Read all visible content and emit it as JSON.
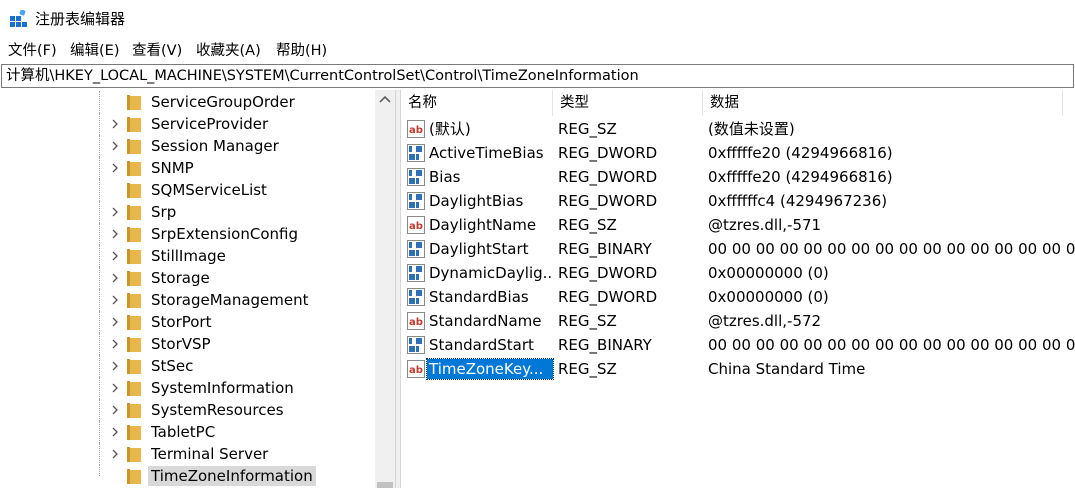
{
  "window": {
    "title": "注册表编辑器",
    "icon": "regedit-icon"
  },
  "menu": [
    {
      "label": "文件(F)"
    },
    {
      "label": "编辑(E)"
    },
    {
      "label": "查看(V)"
    },
    {
      "label": "收藏夹(A)"
    },
    {
      "label": "帮助(H)"
    }
  ],
  "address": {
    "path": "计算机\\HKEY_LOCAL_MACHINE\\SYSTEM\\CurrentControlSet\\Control\\TimeZoneInformation"
  },
  "tree": {
    "items": [
      {
        "label": "ServiceGroupOrder",
        "expandable": false
      },
      {
        "label": "ServiceProvider",
        "expandable": true
      },
      {
        "label": "Session Manager",
        "expandable": true
      },
      {
        "label": "SNMP",
        "expandable": true
      },
      {
        "label": "SQMServiceList",
        "expandable": false
      },
      {
        "label": "Srp",
        "expandable": true
      },
      {
        "label": "SrpExtensionConfig",
        "expandable": true
      },
      {
        "label": "StillImage",
        "expandable": true
      },
      {
        "label": "Storage",
        "expandable": true
      },
      {
        "label": "StorageManagement",
        "expandable": true
      },
      {
        "label": "StorPort",
        "expandable": true
      },
      {
        "label": "StorVSP",
        "expandable": true
      },
      {
        "label": "StSec",
        "expandable": true
      },
      {
        "label": "SystemInformation",
        "expandable": true
      },
      {
        "label": "SystemResources",
        "expandable": true
      },
      {
        "label": "TabletPC",
        "expandable": true
      },
      {
        "label": "Terminal Server",
        "expandable": true
      },
      {
        "label": "TimeZoneInformation",
        "expandable": false,
        "selected": true
      }
    ]
  },
  "list": {
    "columns": {
      "name": "名称",
      "type": "类型",
      "data": "数据"
    },
    "rows": [
      {
        "name": "(默认)",
        "type": "REG_SZ",
        "data": "(数值未设置)",
        "icon": "string-value-icon"
      },
      {
        "name": "ActiveTimeBias",
        "type": "REG_DWORD",
        "data": "0xfffffe20 (4294966816)",
        "icon": "binary-value-icon"
      },
      {
        "name": "Bias",
        "type": "REG_DWORD",
        "data": "0xfffffe20 (4294966816)",
        "icon": "binary-value-icon"
      },
      {
        "name": "DaylightBias",
        "type": "REG_DWORD",
        "data": "0xffffffc4 (4294967236)",
        "icon": "binary-value-icon"
      },
      {
        "name": "DaylightName",
        "type": "REG_SZ",
        "data": "@tzres.dll,-571",
        "icon": "string-value-icon"
      },
      {
        "name": "DaylightStart",
        "type": "REG_BINARY",
        "data": "00 00 00 00 00 00 00 00 00 00 00 00 00 00 00 00",
        "icon": "binary-value-icon"
      },
      {
        "name": "DynamicDaylig...",
        "type": "REG_DWORD",
        "data": "0x00000000 (0)",
        "icon": "binary-value-icon"
      },
      {
        "name": "StandardBias",
        "type": "REG_DWORD",
        "data": "0x00000000 (0)",
        "icon": "binary-value-icon"
      },
      {
        "name": "StandardName",
        "type": "REG_SZ",
        "data": "@tzres.dll,-572",
        "icon": "string-value-icon"
      },
      {
        "name": "StandardStart",
        "type": "REG_BINARY",
        "data": "00 00 00 00 00 00 00 00 00 00 00 00 00 00 00 00",
        "icon": "binary-value-icon"
      },
      {
        "name": "TimeZoneKey...",
        "type": "REG_SZ",
        "data": "China Standard Time",
        "icon": "string-value-icon",
        "selected": true
      }
    ]
  },
  "colors": {
    "selection": "#0078d7",
    "tree_selection": "#d9d9d9",
    "folder": "#e8b64a",
    "string_icon": "#c0392b",
    "binary_icon": "#2f6fb5"
  }
}
